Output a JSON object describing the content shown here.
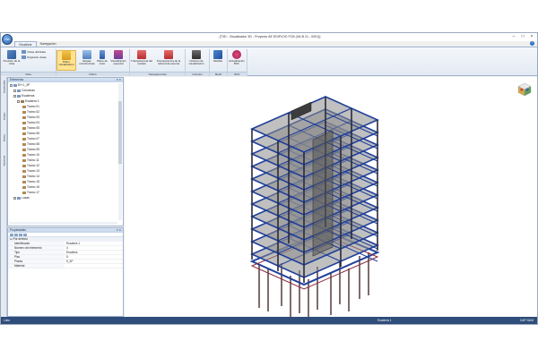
{
  "window": {
    "title": "- [T3D - Visualizador 3D - Proyecto AE EDIFICIO FCB (VA-B 21 - 0001)]",
    "logo_text": "T3D",
    "minimize": "–",
    "maximize": "□",
    "close": "×"
  },
  "tabs": [
    "Visualizar",
    "Navegación"
  ],
  "help": "?",
  "ribbon": {
    "position_label": "Posición de la vista",
    "views_defined": "Vistas definidas",
    "organize_views": "Organizar vistas",
    "plant_visualization": "Plano visualización",
    "stages": "Etapas constructivas",
    "colour_plane": "Plano de color",
    "special_visualization": "Visualización especial",
    "model_transparency": "Transparencia del modelo",
    "reference_transparency": "Transparencia de la referencia externa",
    "visualization_criteria": "Criterios de visualización",
    "measure": "Medida",
    "bcf_update": "Actualización BCF",
    "groups": {
      "vista": "Vista",
      "filtros": "Filtros",
      "transparencias": "Transparencias",
      "criterios": "Criterios",
      "medir": "Medir",
      "bcf": "BCF"
    }
  },
  "side_tabs": [
    "Elementos",
    "Filtros",
    "Vistas",
    "Escenas"
  ],
  "elements_panel": {
    "title": "Elementos",
    "controls": "▾ ✕",
    "root": "EH 1_3P",
    "columns": "Columnas",
    "stairs": "Escaleras",
    "stair1": "Escalera 1",
    "tramos": [
      "Tramo 01",
      "Tramo 02",
      "Tramo 03",
      "Tramo 04",
      "Tramo 05",
      "Tramo 06",
      "Tramo 07",
      "Tramo 08",
      "Tramo 09",
      "Tramo 10",
      "Tramo 11",
      "Tramo 12",
      "Tramo 13",
      "Tramo 14",
      "Tramo 15",
      "Tramo 16",
      "Tramo 17"
    ],
    "losas": "Losas"
  },
  "properties_panel": {
    "title": "Propiedades",
    "controls": "▾ ✕",
    "category": "Por defecto",
    "rows": [
      {
        "name": "Identificador",
        "value": "Escalera 1"
      },
      {
        "name": "Número del elemento",
        "value": "4"
      },
      {
        "name": "Tipo",
        "value": "Escalera"
      },
      {
        "name": "Piso",
        "value": "5"
      },
      {
        "name": "Planta",
        "value": "5_3P"
      },
      {
        "name": "Material",
        "value": ""
      }
    ]
  },
  "status": {
    "left": "Listo",
    "middle": "Escalera 1",
    "right": "CAP NUM"
  },
  "colors": {
    "beam_blue": "#1f3f9a",
    "slab_gray": "#8c8c8c",
    "column_dark": "#4a2c2c",
    "status_bar": "#2f4d7a"
  }
}
